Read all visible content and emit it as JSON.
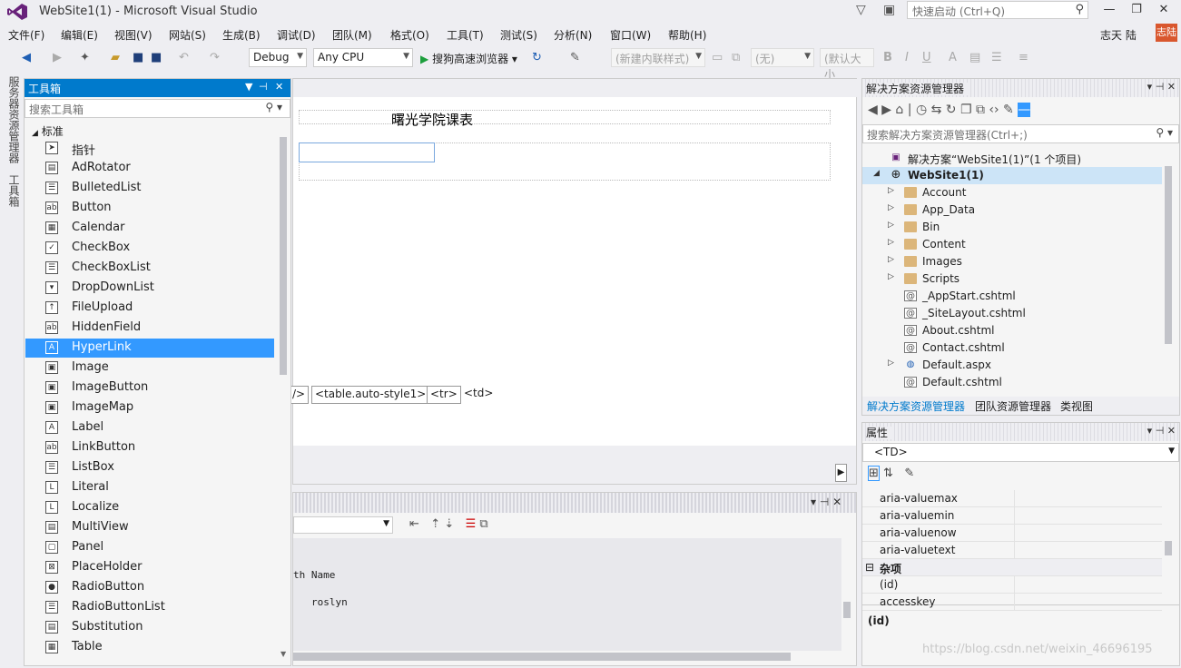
{
  "window": {
    "title": "WebSite1(1) - Microsoft Visual Studio"
  },
  "quick_launch": {
    "placeholder": "快速启动 (Ctrl+Q)"
  },
  "menu": [
    "文件(F)",
    "编辑(E)",
    "视图(V)",
    "网站(S)",
    "生成(B)",
    "调试(D)",
    "团队(M)",
    "格式(O)",
    "工具(T)",
    "测试(S)",
    "分析(N)",
    "窗口(W)",
    "帮助(H)"
  ],
  "user": {
    "name": "志天 陆",
    "badge": "志陆"
  },
  "toolbar": {
    "config": "Debug",
    "platform": "Any CPU",
    "run_label": "搜狗高速浏览器",
    "style_combo": "(新建内联样式)",
    "target_combo": "(无)",
    "font_combo": "(默认大小",
    "bold": "B",
    "italic": "I",
    "underline": "U"
  },
  "left_tabs": [
    "服务器资源管理器",
    "工具箱"
  ],
  "toolbox": {
    "title": "工具箱",
    "search_placeholder": "搜索工具箱",
    "group": "标准",
    "items": [
      {
        "label": "指针",
        "icon": "pointer-icon",
        "glyph": "➤"
      },
      {
        "label": "AdRotator",
        "icon": "adrotator-icon",
        "glyph": "▤"
      },
      {
        "label": "BulletedList",
        "icon": "bulleted-list-icon",
        "glyph": "☰"
      },
      {
        "label": "Button",
        "icon": "button-icon",
        "glyph": "ab"
      },
      {
        "label": "Calendar",
        "icon": "calendar-icon",
        "glyph": "▦"
      },
      {
        "label": "CheckBox",
        "icon": "checkbox-icon",
        "glyph": "✓"
      },
      {
        "label": "CheckBoxList",
        "icon": "checkbox-list-icon",
        "glyph": "☰"
      },
      {
        "label": "DropDownList",
        "icon": "dropdown-list-icon",
        "glyph": "▾"
      },
      {
        "label": "FileUpload",
        "icon": "file-upload-icon",
        "glyph": "↑"
      },
      {
        "label": "HiddenField",
        "icon": "hidden-field-icon",
        "glyph": "ab"
      },
      {
        "label": "HyperLink",
        "icon": "hyperlink-icon",
        "glyph": "A"
      },
      {
        "label": "Image",
        "icon": "image-icon",
        "glyph": "▣"
      },
      {
        "label": "ImageButton",
        "icon": "image-button-icon",
        "glyph": "▣"
      },
      {
        "label": "ImageMap",
        "icon": "image-map-icon",
        "glyph": "▣"
      },
      {
        "label": "Label",
        "icon": "label-icon",
        "glyph": "A"
      },
      {
        "label": "LinkButton",
        "icon": "link-button-icon",
        "glyph": "ab"
      },
      {
        "label": "ListBox",
        "icon": "listbox-icon",
        "glyph": "☰"
      },
      {
        "label": "Literal",
        "icon": "literal-icon",
        "glyph": "L"
      },
      {
        "label": "Localize",
        "icon": "localize-icon",
        "glyph": "L"
      },
      {
        "label": "MultiView",
        "icon": "multiview-icon",
        "glyph": "▤"
      },
      {
        "label": "Panel",
        "icon": "panel-icon",
        "glyph": "▢"
      },
      {
        "label": "PlaceHolder",
        "icon": "placeholder-icon",
        "glyph": "⊠"
      },
      {
        "label": "RadioButton",
        "icon": "radio-button-icon",
        "glyph": "●"
      },
      {
        "label": "RadioButtonList",
        "icon": "radio-button-list-icon",
        "glyph": "☰"
      },
      {
        "label": "Substitution",
        "icon": "substitution-icon",
        "glyph": "▤"
      },
      {
        "label": "Table",
        "icon": "table-icon",
        "glyph": "▦"
      }
    ],
    "selected_index": 10
  },
  "editor": {
    "heading": "曙光学院课表",
    "breadcrumb": [
      "/>",
      "<table.auto-style1>",
      "<tr>",
      "<td>"
    ]
  },
  "output": {
    "column_text": "th Name",
    "row_value": "roslyn"
  },
  "solution_explorer": {
    "title": "解决方案资源管理器",
    "search_placeholder": "搜索解决方案资源管理器(Ctrl+;)",
    "tree": [
      {
        "label": "解决方案“WebSite1(1)”(1 个项目)",
        "level": 0,
        "kind": "solution",
        "expander": ""
      },
      {
        "label": "WebSite1(1)",
        "level": 1,
        "kind": "web",
        "expander": "◢",
        "bold": true,
        "selected": true
      },
      {
        "label": "Account",
        "level": 2,
        "kind": "folder",
        "expander": "▷"
      },
      {
        "label": "App_Data",
        "level": 2,
        "kind": "folder",
        "expander": "▷"
      },
      {
        "label": "Bin",
        "level": 2,
        "kind": "folder",
        "expander": "▷"
      },
      {
        "label": "Content",
        "level": 2,
        "kind": "folder",
        "expander": "▷"
      },
      {
        "label": "Images",
        "level": 2,
        "kind": "folder",
        "expander": "▷"
      },
      {
        "label": "Scripts",
        "level": 2,
        "kind": "folder",
        "expander": "▷"
      },
      {
        "label": "_AppStart.cshtml",
        "level": 2,
        "kind": "file",
        "expander": ""
      },
      {
        "label": "_SiteLayout.cshtml",
        "level": 2,
        "kind": "file",
        "expander": ""
      },
      {
        "label": "About.cshtml",
        "level": 2,
        "kind": "file",
        "expander": ""
      },
      {
        "label": "Contact.cshtml",
        "level": 2,
        "kind": "file",
        "expander": ""
      },
      {
        "label": "Default.aspx",
        "level": 2,
        "kind": "aspx",
        "expander": "▷"
      },
      {
        "label": "Default.cshtml",
        "level": 2,
        "kind": "file",
        "expander": ""
      }
    ],
    "tabs": [
      "解决方案资源管理器",
      "团队资源管理器",
      "类视图"
    ]
  },
  "properties": {
    "title": "属性",
    "object": "<TD>",
    "rows": [
      {
        "name": "aria-valuemax",
        "category": false
      },
      {
        "name": "aria-valuemin",
        "category": false
      },
      {
        "name": "aria-valuenow",
        "category": false
      },
      {
        "name": "aria-valuetext",
        "category": false
      },
      {
        "name": "杂项",
        "category": true
      },
      {
        "name": "(id)",
        "category": false
      },
      {
        "name": "accesskey",
        "category": false
      }
    ],
    "description": "(id)"
  },
  "watermark": "https://blog.csdn.net/weixin_46696195"
}
